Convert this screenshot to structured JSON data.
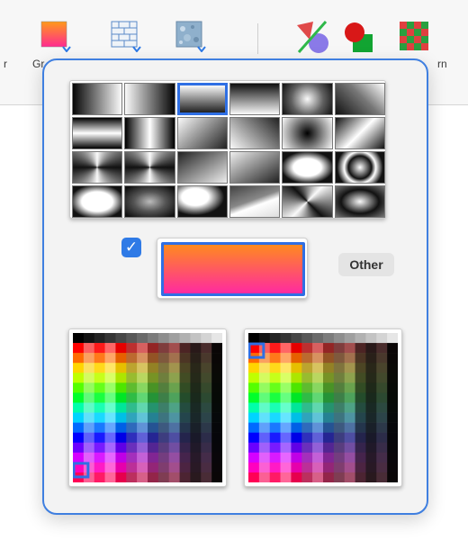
{
  "toolbar": {
    "items": [
      {
        "label": "r",
        "icon": "partial-button-icon"
      },
      {
        "label": "Gr",
        "icon": "gradient-fill-icon"
      },
      {
        "label": "",
        "icon": "brick-pattern-icon"
      },
      {
        "label": "",
        "icon": "texture-fill-icon"
      },
      {
        "label": "",
        "icon": "no-fill-shapes-icon"
      },
      {
        "label": "",
        "icon": "shape-fill-icon"
      },
      {
        "label": "rn",
        "icon": "pattern-fill-icon"
      }
    ]
  },
  "popover": {
    "gradient_presets": {
      "rows": 4,
      "columns": 6,
      "selected_index": 2
    },
    "gradient_enabled": true,
    "current_gradient": {
      "start_color": "#ff8a1f",
      "end_color": "#ff2aa0"
    },
    "other_button_label": "Other",
    "palettes": [
      {
        "name": "start-color-palette",
        "selected": {
          "column": 0,
          "row": 13
        }
      },
      {
        "name": "end-color-palette",
        "selected": {
          "column": 0,
          "row": 1
        }
      }
    ]
  },
  "colors": {
    "accent": "#2f6fe4",
    "popover_border": "#3f7fe0"
  }
}
